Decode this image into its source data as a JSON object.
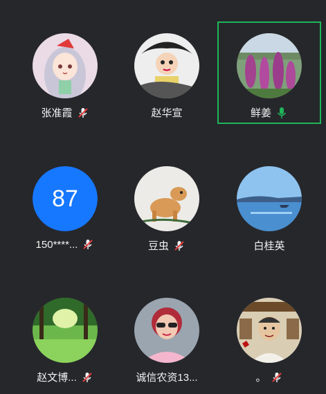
{
  "accent_speaking": "#1fb55a",
  "number_avatar_color": "#1677ff",
  "participants": [
    {
      "name": "张准霞",
      "mic": "muted",
      "avatar": "anime-girl-avatar"
    },
    {
      "name": "赵华宣",
      "mic": "none",
      "avatar": "cartoon-boy-avatar"
    },
    {
      "name": "鲜姜",
      "mic": "speaking",
      "avatar": "purple-flowers-avatar",
      "active": true
    },
    {
      "name": "150****...",
      "mic": "muted",
      "avatar": "number-avatar",
      "avatar_text": "87"
    },
    {
      "name": "豆虫",
      "mic": "muted",
      "avatar": "horse-drawing-avatar"
    },
    {
      "name": "白桂英",
      "mic": "none",
      "avatar": "lake-landscape-avatar"
    },
    {
      "name": "赵文博...",
      "mic": "muted",
      "avatar": "green-trees-avatar"
    },
    {
      "name": "诚信农资13...",
      "mic": "none",
      "avatar": "woman-sunglasses-avatar"
    },
    {
      "name": "。",
      "mic": "muted",
      "avatar": "cartoon-man-avatar"
    }
  ]
}
